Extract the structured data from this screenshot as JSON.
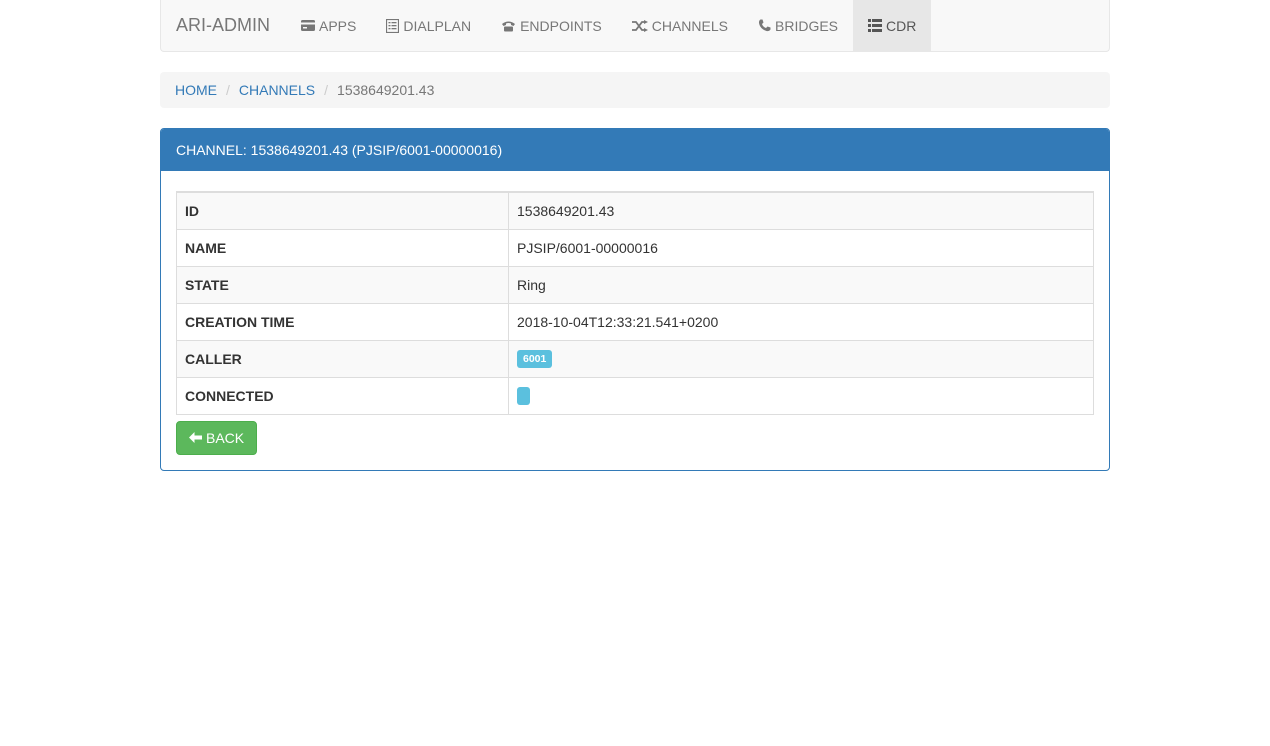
{
  "navbar": {
    "brand": "ARI-ADMIN",
    "items": [
      {
        "label": "APPS",
        "icon": "credit-card-icon"
      },
      {
        "label": "DIALPLAN",
        "icon": "list-alt-icon"
      },
      {
        "label": "ENDPOINTS",
        "icon": "phone-alt-icon"
      },
      {
        "label": "CHANNELS",
        "icon": "random-icon"
      },
      {
        "label": "BRIDGES",
        "icon": "earphone-icon"
      },
      {
        "label": "CDR",
        "icon": "th-list-icon",
        "active": true
      }
    ]
  },
  "breadcrumb": {
    "home": "HOME",
    "channels": "CHANNELS",
    "current": "1538649201.43"
  },
  "panel": {
    "title": "CHANNEL: 1538649201.43 (PJSIP/6001-00000016)",
    "accent_color": "#337ab7"
  },
  "details": {
    "rows": [
      {
        "label": "ID",
        "value": "1538649201.43"
      },
      {
        "label": "NAME",
        "value": "PJSIP/6001-00000016"
      },
      {
        "label": "STATE",
        "value": "Ring"
      },
      {
        "label": "CREATION TIME",
        "value": "2018-10-04T12:33:21.541+0200"
      },
      {
        "label": "CALLER",
        "value": "6001"
      },
      {
        "label": "CONNECTED",
        "value": ""
      }
    ]
  },
  "back_button": {
    "label": "BACK",
    "icon": "arrow-left-icon",
    "color": "#5cb85c"
  },
  "badge_color": "#5bc0de"
}
